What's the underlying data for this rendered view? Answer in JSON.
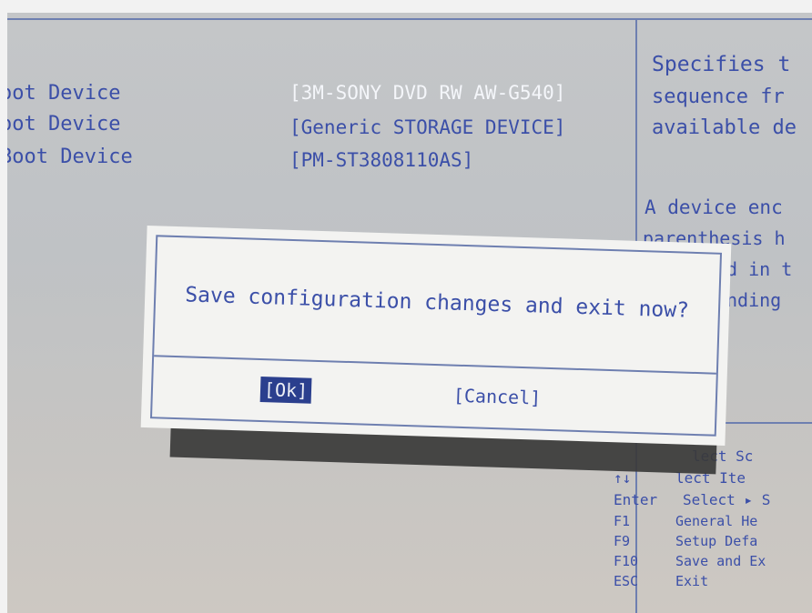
{
  "boot_list": {
    "labels": [
      "oot Device",
      "oot Device",
      "Boot Device"
    ],
    "values": [
      "[3M-SONY DVD RW AW-G540]",
      "[Generic STORAGE DEVICE]",
      "[PM-ST3808110AS]"
    ]
  },
  "help_panel": {
    "lines": [
      "Specifies t",
      "sequence fr",
      "available de",
      "A device enc",
      "parenthesis h",
      "d in t",
      "nding"
    ]
  },
  "key_legend": [
    {
      "key": "",
      "action": "lect Sc"
    },
    {
      "key": "↑↓",
      "action": "lect Ite"
    },
    {
      "key": "Enter",
      "action": "Select ▸ S"
    },
    {
      "key": "F1",
      "action": "General He"
    },
    {
      "key": "F9",
      "action": "Setup Defa"
    },
    {
      "key": "F10",
      "action": "Save and Ex"
    },
    {
      "key": "ESC",
      "action": "Exit"
    }
  ],
  "dialog": {
    "message": "Save configuration changes and exit now?",
    "ok_label": "[Ok]",
    "cancel_label": "[Cancel]"
  },
  "colors": {
    "text_blue": "#3b4fa8",
    "line_blue": "#6e7fb0",
    "selected_bg": "#2b3f8e"
  }
}
